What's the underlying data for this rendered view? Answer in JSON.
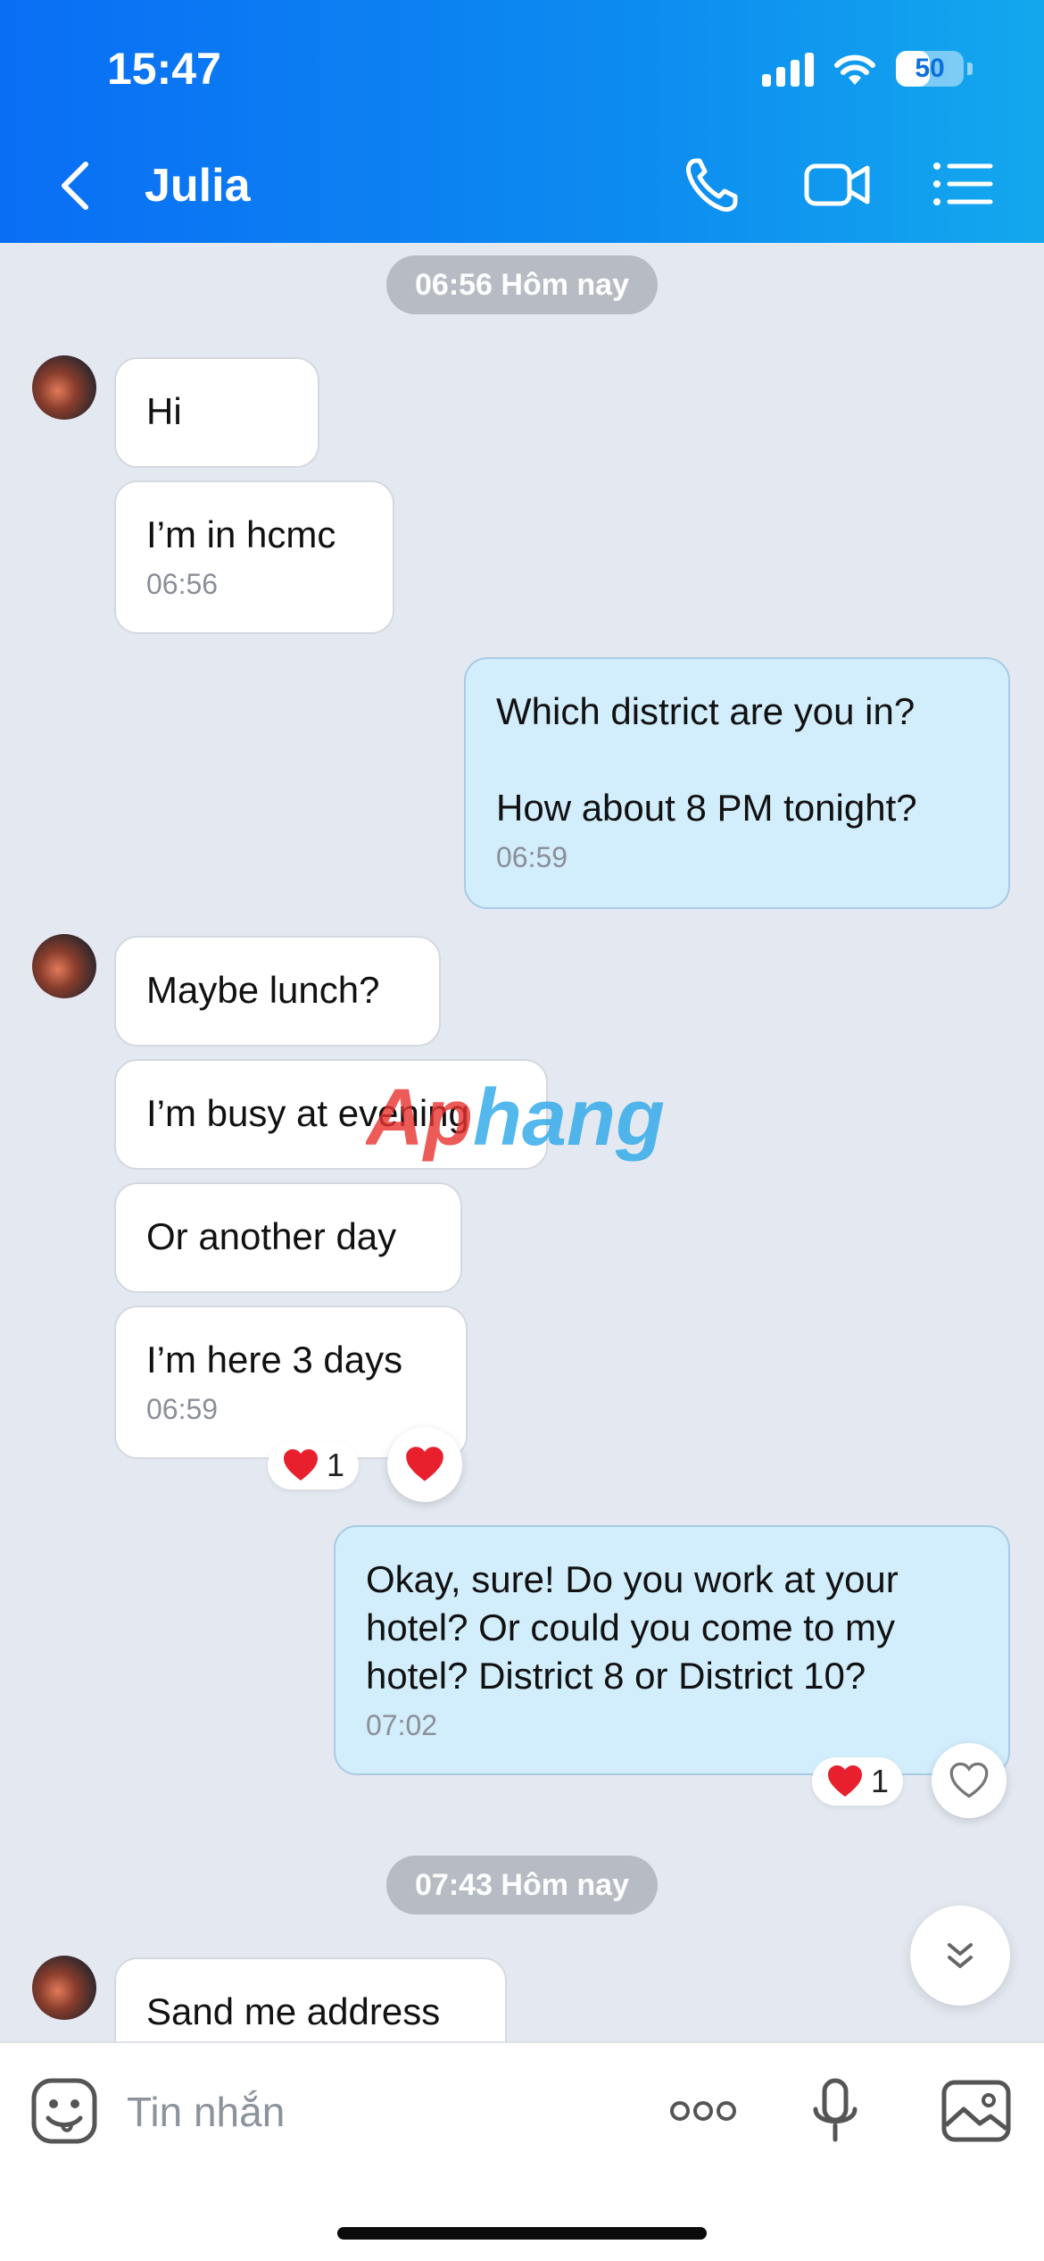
{
  "status_bar": {
    "time": "15:47",
    "battery": "50"
  },
  "header": {
    "contact_name": "Julia"
  },
  "chat": {
    "separators": [
      "06:56 Hôm nay",
      "07:43 Hôm nay"
    ],
    "messages": [
      {
        "text": "Hi"
      },
      {
        "text": "I’m in hcmc",
        "time": "06:56"
      },
      {
        "text": "Which district are you in?\n\nHow about 8 PM tonight?",
        "time": "06:59"
      },
      {
        "text": "Maybe lunch?"
      },
      {
        "text": "I’m busy at evening"
      },
      {
        "text": "Or another day"
      },
      {
        "text": "I’m here 3 days",
        "time": "06:59"
      },
      {
        "text": "Okay, sure! Do you work at your hotel? Or could you come to my hotel? District 8 or District 10?",
        "time": "07:02"
      },
      {
        "text": "Sand me address"
      }
    ],
    "reactions": [
      {
        "emoji": "heart",
        "count": "1"
      },
      {
        "emoji": "heart",
        "count": "1"
      }
    ]
  },
  "watermark": {
    "text": "Aphang"
  },
  "input_bar": {
    "placeholder": "Tin nhắn"
  },
  "colors": {
    "header_start": "#0a6ef5",
    "header_end": "#13a8ee",
    "outgoing_bubble": "#d2edfc",
    "incoming_bubble": "#ffffff",
    "chat_background": "#e4e8f0",
    "heart": "#e8202e"
  },
  "icons": {
    "header": [
      "back-chevron-icon",
      "phone-icon",
      "video-call-icon",
      "list-menu-icon"
    ],
    "input_bar": [
      "sticker-icon",
      "more-options-icon",
      "microphone-icon",
      "image-gallery-icon"
    ],
    "status": [
      "cellular-signal-icon",
      "wifi-icon",
      "battery-icon"
    ]
  }
}
